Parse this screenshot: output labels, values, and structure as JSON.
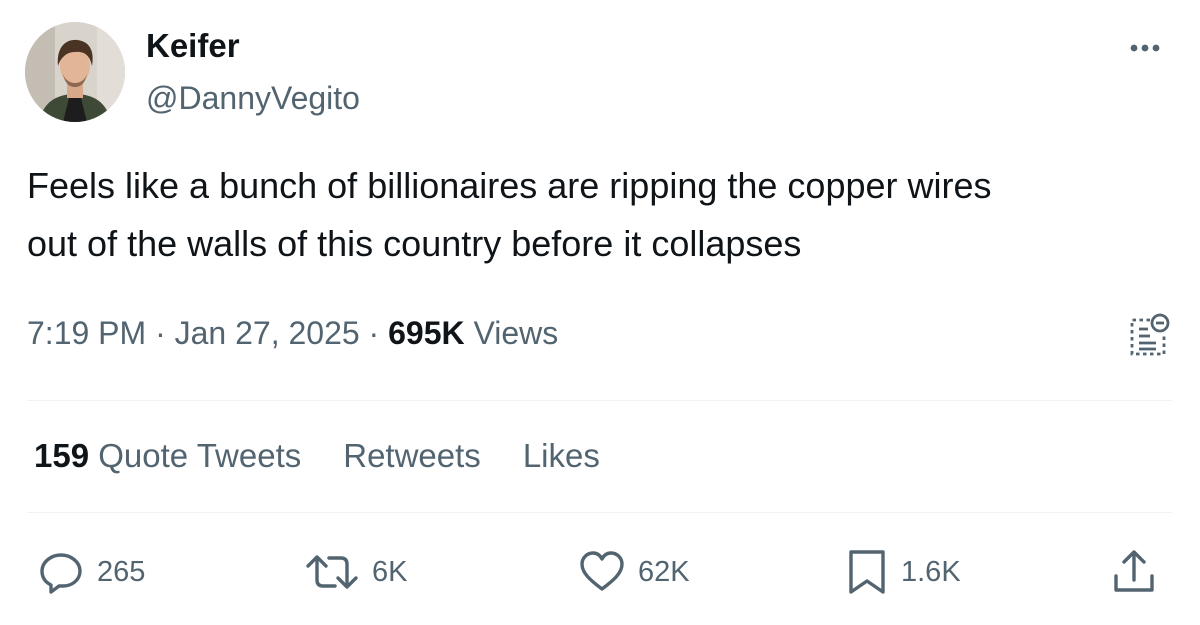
{
  "author": {
    "display_name": "Keifer",
    "handle": "@DannyVegito"
  },
  "tweet": {
    "text_line1": "Feels like a bunch of billionaires are ripping the copper wires",
    "text_line2": "out of the walls of this country before it collapses",
    "time": "7:19 PM",
    "date": "Jan 27, 2025",
    "separator": "·",
    "views_count": "695K",
    "views_label": "Views"
  },
  "stats": {
    "quote_count": "159",
    "quote_label": "Quote Tweets",
    "retweets_label": "Retweets",
    "likes_label": "Likes"
  },
  "actions": {
    "replies": "265",
    "retweets": "6K",
    "likes": "62K",
    "bookmarks": "1.6K"
  },
  "icons": {
    "more": "more-icon",
    "analytics": "analytics-icon",
    "reply": "reply-icon",
    "retweet": "retweet-icon",
    "like": "heart-icon",
    "bookmark": "bookmark-icon",
    "share": "share-icon"
  },
  "colors": {
    "text_primary": "#0f1419",
    "text_secondary": "#536471",
    "divider": "#eff3f4",
    "background": "#ffffff"
  }
}
